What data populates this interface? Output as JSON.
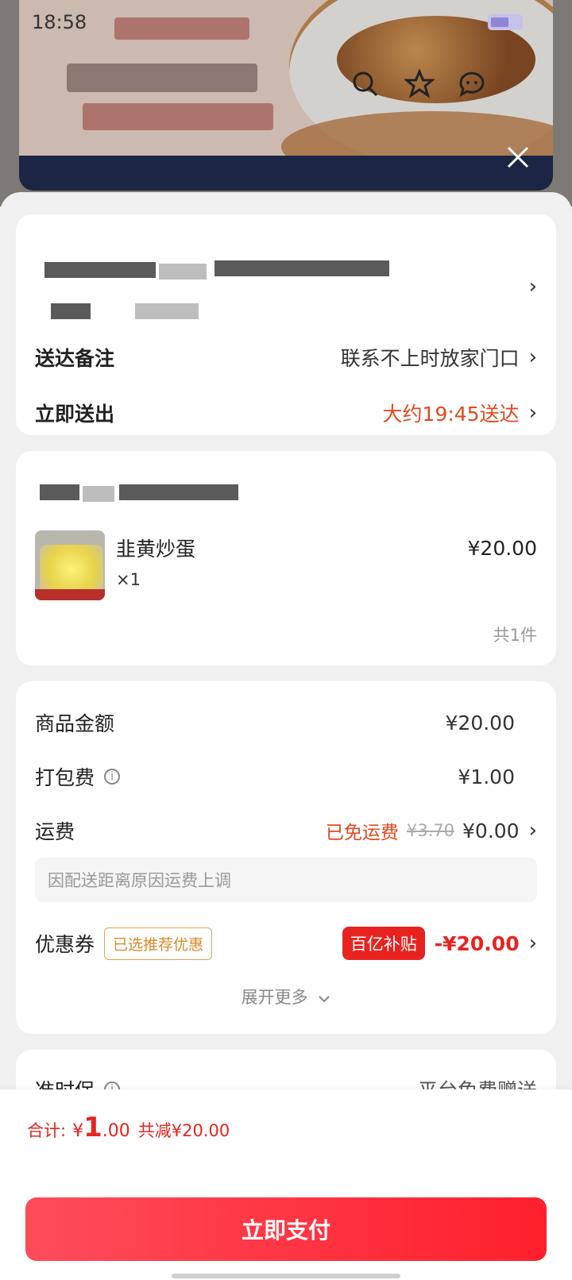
{
  "status_bar": {
    "time": "18:58"
  },
  "address": {
    "arrow": "›"
  },
  "delivery": {
    "remark_label": "送达备注",
    "remark_value": "联系不上时放家门口",
    "time_label": "立即送出",
    "time_value": "大约19:45送达",
    "arrow": "›"
  },
  "order_item": {
    "name": "韭黄炒蛋",
    "qty": "×1",
    "price": "¥20.00",
    "total_count": "共1件"
  },
  "fees": {
    "goods_label": "商品金额",
    "goods_value": "¥20.00",
    "pack_label": "打包费",
    "pack_value": "¥1.00",
    "freight_label": "运费",
    "freight_free_text": "已免运费",
    "freight_original": "¥3.70",
    "freight_value": "¥0.00",
    "freight_note": "因配送距离原因运费上调",
    "coupon_label": "优惠券",
    "coupon_tag": "已选推荐优惠",
    "subsidy_tag": "百亿补贴",
    "coupon_value": "-¥20.00",
    "expand_more": "展开更多"
  },
  "guarantee": {
    "label": "准时保",
    "value": "平台免费赠送"
  },
  "footer": {
    "total_label": "合计:",
    "currency": "¥",
    "total_int": "1",
    "total_dec": ".00",
    "discount_text": "共减¥20.00",
    "pay_button": "立即支付"
  },
  "colors": {
    "accent_red": "#e8231f",
    "price_red": "#e04a1f",
    "pay_gradient_start": "#ff4c5a",
    "pay_gradient_end": "#ff1f2d"
  }
}
